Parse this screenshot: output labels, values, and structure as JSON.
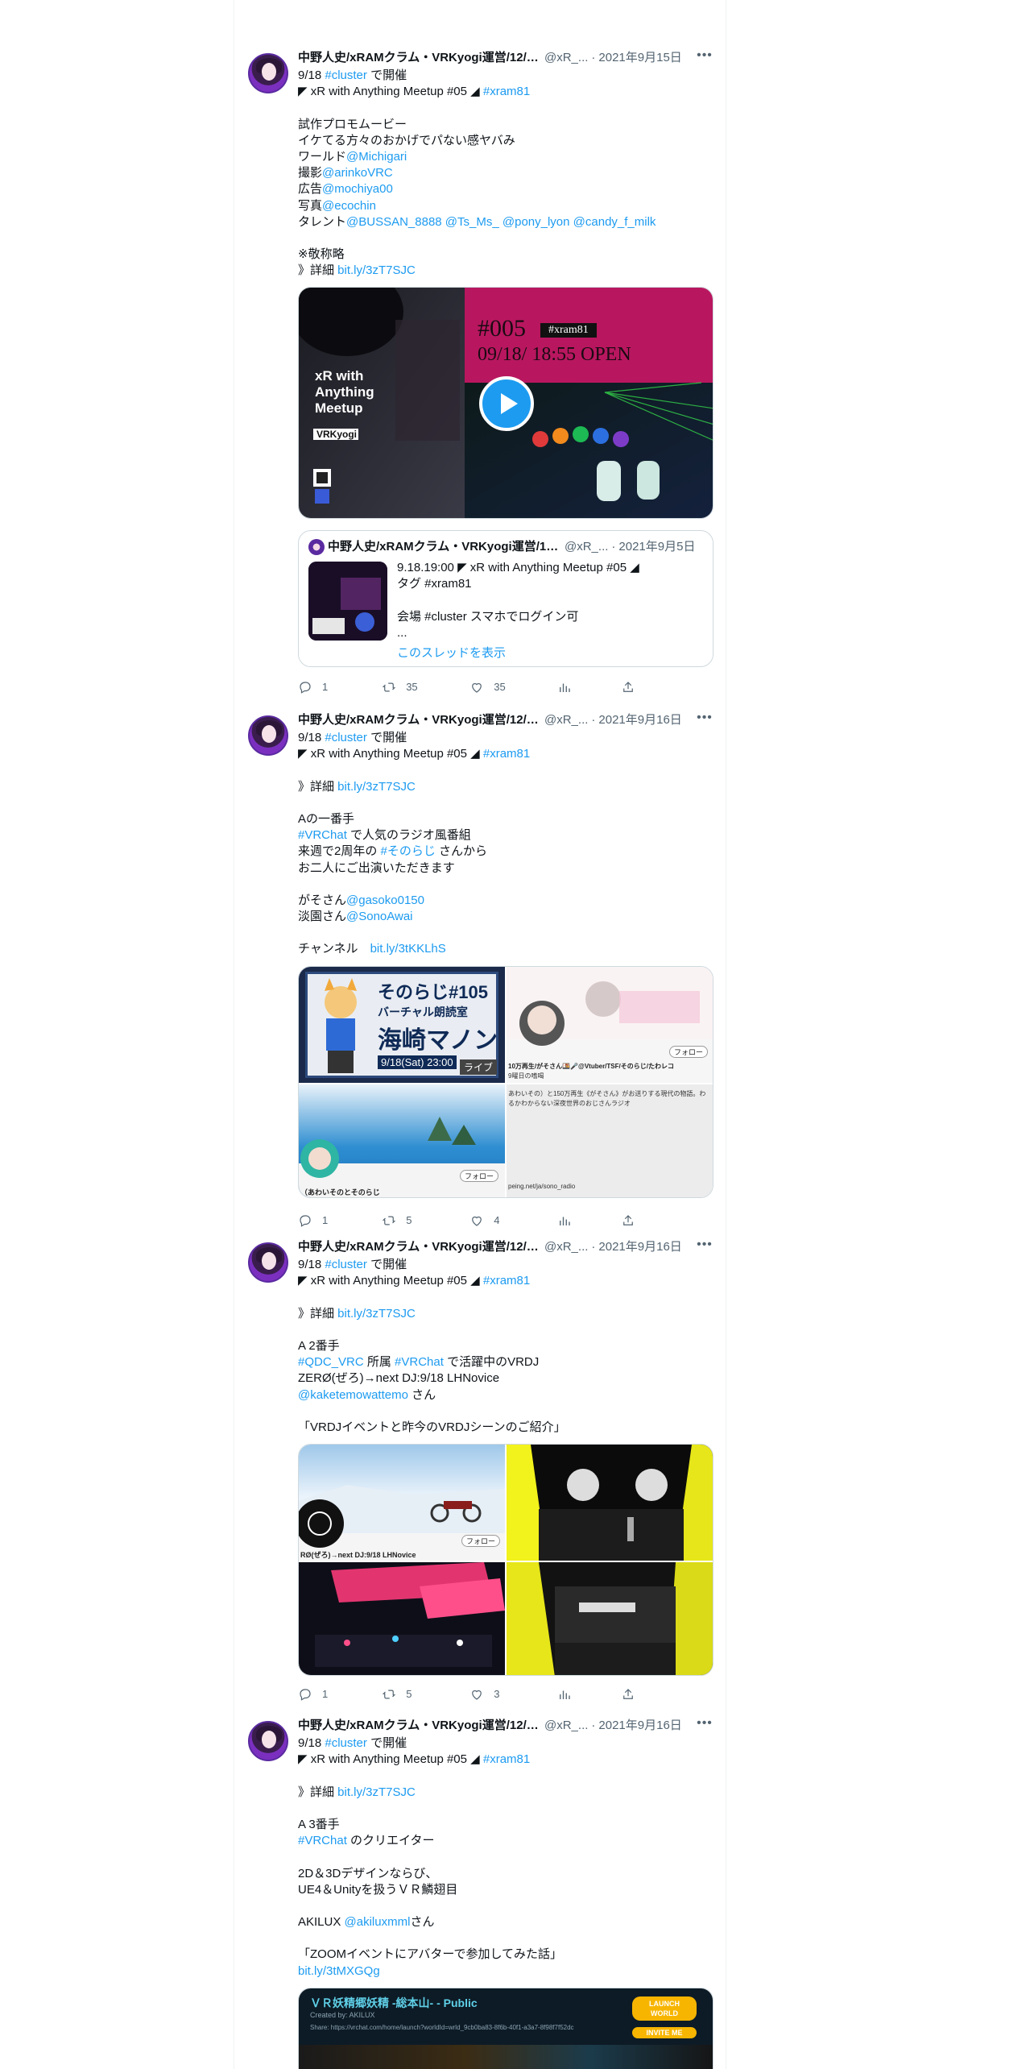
{
  "tweets": [
    {
      "name": "中野人史/xRAMクラム・VRKyogi運営/12/1...",
      "handle": "@xR_...",
      "dot": "·",
      "date": "2021年9月15日",
      "lines": [
        [
          "9/18 ",
          {
            "t": "#cluster",
            "link": true
          },
          " で開催"
        ],
        [
          "◤ xR with Anything Meetup #05 ◢ ",
          {
            "t": "#xram81",
            "link": true
          }
        ],
        [],
        [
          "試作プロモムービー"
        ],
        [
          "イケてる方々のおかげでパない感ヤバみ"
        ],
        [
          "ワールド",
          {
            "t": "@Michigari",
            "link": true
          }
        ],
        [
          "撮影",
          {
            "t": "@arinkoVRC",
            "link": true
          }
        ],
        [
          "広告",
          {
            "t": "@mochiya00",
            "link": true
          }
        ],
        [
          "写真",
          {
            "t": "@ecochin",
            "link": true
          }
        ],
        [
          "タレント",
          {
            "t": "@BUSSAN_8888 @Ts_Ms_ @pony_lyon @candy_f_milk",
            "link": true
          }
        ],
        [],
        [
          "※敬称略"
        ],
        [
          "》詳細 ",
          {
            "t": "bit.ly/3zT7SJC",
            "link": true
          }
        ]
      ],
      "video": {
        "poster_title": "xR with Anything Meetup",
        "brand": "VRKyogi",
        "number": "#005",
        "tag": "#xram81",
        "open": "09/18/ 18:55 OPEN"
      },
      "quote": {
        "name": "中野人史/xRAMクラム・VRKyogi運営/12/...",
        "handle": "@xR_...",
        "dot": "·",
        "date": "2021年9月5日",
        "lines": [
          "9.18.19:00 ◤ xR with Anything Meetup #05 ◢",
          "タグ #xram81",
          "",
          "会場 #cluster スマホでログイン可",
          "..."
        ],
        "show_thread": "このスレッドを表示"
      },
      "stats": {
        "replies": "1",
        "retweets": "35",
        "likes": "35"
      }
    },
    {
      "name": "中野人史/xRAMクラム・VRKyogi運営/12/1...",
      "handle": "@xR_...",
      "dot": "·",
      "date": "2021年9月16日",
      "lines": [
        [
          "9/18 ",
          {
            "t": "#cluster",
            "link": true
          },
          " で開催"
        ],
        [
          "◤ xR with Anything Meetup #05 ◢ ",
          {
            "t": "#xram81",
            "link": true
          }
        ],
        [],
        [
          "》詳細 ",
          {
            "t": "bit.ly/3zT7SJC",
            "link": true
          }
        ],
        [],
        [
          "Aの一番手"
        ],
        [
          {
            "t": "#VRChat",
            "link": true
          },
          " で人気のラジオ風番組"
        ],
        [
          "来週で2周年の ",
          {
            "t": "#そのらじ",
            "link": true
          },
          " さんから"
        ],
        [
          "お二人にご出演いただきます"
        ],
        [],
        [
          "がそさん",
          {
            "t": "@gasoko0150",
            "link": true
          }
        ],
        [
          "淡園さん",
          {
            "t": "@SonoAwai",
            "link": true
          }
        ],
        [],
        [
          "チャンネル　",
          {
            "t": "bit.ly/3tKKLhS",
            "link": true
          }
        ]
      ],
      "grid": {
        "title": "そのらじ#105",
        "subtitle": "バーチャル朗読室",
        "guest": "海崎マノン",
        "time": "9/18(Sat) 23:00",
        "live": "ライブ",
        "follow": "フォロー",
        "caption_a": "10万再生/がそさん🍱🎤@Vtuber/TSF/そのらじ/たわレコ",
        "caption_b": "9曜日の嗜喝",
        "caption_c": "（あわいそのとそのらじ",
        "caption_d": "あわいその）と150万再生《がそさん》がお送りする現代の物語。わるかわからない深夜世界のおじさんラジオ",
        "caption_e": "peing.net/ja/sono_radio"
      },
      "stats": {
        "replies": "1",
        "retweets": "5",
        "likes": "4"
      }
    },
    {
      "name": "中野人史/xRAMクラム・VRKyogi運営/12/1...",
      "handle": "@xR_...",
      "dot": "·",
      "date": "2021年9月16日",
      "lines": [
        [
          "9/18 ",
          {
            "t": "#cluster",
            "link": true
          },
          " で開催"
        ],
        [
          "◤ xR with Anything Meetup #05 ◢ ",
          {
            "t": "#xram81",
            "link": true
          }
        ],
        [],
        [
          "》詳細 ",
          {
            "t": "bit.ly/3zT7SJC",
            "link": true
          }
        ],
        [],
        [
          "A 2番手"
        ],
        [
          {
            "t": "#QDC_VRC",
            "link": true
          },
          " 所属 ",
          {
            "t": "#VRChat",
            "link": true
          },
          " で活躍中のVRDJ"
        ],
        [
          "ZERØ(ぜろ)→next DJ:9/18 LHNovice"
        ],
        [
          {
            "t": "@kaketemowattemo",
            "link": true
          },
          " さん"
        ],
        [],
        [
          "「VRDJイベントと昨今のVRDJシーンのご紹介」"
        ]
      ],
      "grid": {
        "profile": "RØ(ぜろ)→next DJ:9/18 LHNovice",
        "follow": "フォロー"
      },
      "stats": {
        "replies": "1",
        "retweets": "5",
        "likes": "3"
      }
    },
    {
      "name": "中野人史/xRAMクラム・VRKyogi運営/12/1...",
      "handle": "@xR_...",
      "dot": "·",
      "date": "2021年9月16日",
      "lines": [
        [
          "9/18 ",
          {
            "t": "#cluster",
            "link": true
          },
          " で開催"
        ],
        [
          "◤ xR with Anything Meetup #05 ◢ ",
          {
            "t": "#xram81",
            "link": true
          }
        ],
        [],
        [
          "》詳細 ",
          {
            "t": "bit.ly/3zT7SJC",
            "link": true
          }
        ],
        [],
        [
          "A 3番手"
        ],
        [
          " ",
          {
            "t": "#VRChat",
            "link": true
          },
          " のクリエイター"
        ],
        [],
        [
          "2D＆3Dデザインならび、"
        ],
        [
          "UE4＆Unityを扱うＶＲ鱗翅目"
        ],
        [],
        [
          "AKILUX ",
          {
            "t": "@akiluxmml",
            "link": true
          },
          "さん"
        ],
        [],
        [
          "「ZOOMイベントにアバターで参加してみた話」"
        ],
        [
          {
            "t": "bit.ly/3tMXGQg",
            "link": true
          }
        ]
      ],
      "card": {
        "title": "ＶＲ妖精郷妖精 -総本山- - Public",
        "creator": "Created by: AKILUX",
        "share": "Share: https://vrchat.com/home/launch?worldId=wrld_9cb0ba83-8f6b-40f1-a3a7-8f98f7f52dc",
        "launch": "LAUNCH WORLD",
        "invite": "INVITE ME"
      },
      "stats": {
        "replies": "",
        "retweets": "",
        "likes": ""
      }
    }
  ],
  "colors": {
    "link": "#1d9bf0",
    "text": "#0f1419",
    "muted": "#536471",
    "border": "#cfd9de"
  }
}
